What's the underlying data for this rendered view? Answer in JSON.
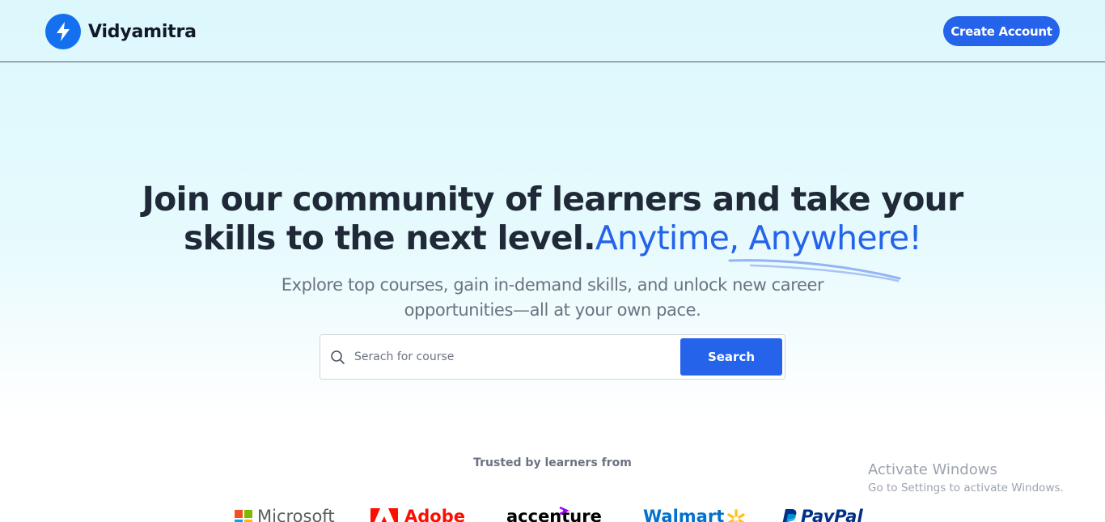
{
  "header": {
    "brand": "Vidyamitra",
    "logo_icon": "lightning-bolt-icon",
    "create_account_label": "Create Account"
  },
  "hero": {
    "title_line1": "Join our community of learners and take your",
    "title_line2_prefix": "skills to the next level.",
    "title_line2_accent": "Anytime, Anywhere!",
    "subtitle": "Explore top courses, gain in-demand skills, and unlock new career opportunities—all at your own pace."
  },
  "search": {
    "placeholder": "Serach for course",
    "value": "",
    "button_label": "Search",
    "icon": "search-icon"
  },
  "trusted": {
    "label": "Trusted by learners from",
    "brands": [
      "Microsoft",
      "Adobe",
      "accenture",
      "Walmart",
      "PayPal"
    ]
  },
  "watermark": {
    "title": "Activate Windows",
    "subtitle": "Go to Settings to activate Windows."
  },
  "colors": {
    "accent": "#2563eb",
    "logo_bg": "#1570ef",
    "heading": "#1f2937",
    "muted": "#6b7280"
  }
}
